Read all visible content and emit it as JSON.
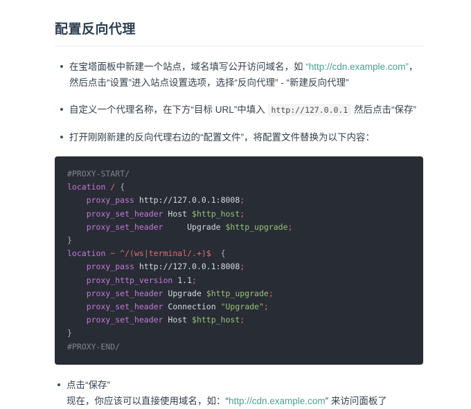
{
  "page": {
    "title": "配置反向代理"
  },
  "colors": {
    "link": "#4aa08c",
    "title": "#2c3e50",
    "code_background": "#282c34",
    "code_keyword": "#c678dd",
    "code_string": "#98c379",
    "code_comment": "#7f848e",
    "code_operator": "#e06c75",
    "code_plain": "#d7dae0"
  },
  "steps": [
    {
      "parts": [
        {
          "type": "text",
          "value": "在宝塔面板中新建一个站点，域名填写公开访问域名，如 "
        },
        {
          "type": "quote_open",
          "value": "“"
        },
        {
          "type": "link",
          "value": "http://cdn.example.com"
        },
        {
          "type": "quote_close",
          "value": "”"
        },
        {
          "type": "text",
          "value": "，然后点击“设置”进入站点设置选项，选择“反向代理” - “新建反向代理”"
        }
      ]
    },
    {
      "parts": [
        {
          "type": "text",
          "value": "自定义一个代理名称，在下方“目标 URL”中填入 "
        },
        {
          "type": "code",
          "value": "http://127.0.0.1"
        },
        {
          "type": "text",
          "value": " 然后点击“保存”"
        }
      ]
    },
    {
      "parts": [
        {
          "type": "text",
          "value": "打开刚刚新建的反向代理右边的“配置文件”，将配置文件替换为以下内容："
        }
      ]
    }
  ],
  "code_block": {
    "language": "nginx",
    "lines": [
      [
        {
          "t": "comment",
          "v": "#PROXY-START/"
        }
      ],
      [
        {
          "t": "keyword",
          "v": "location"
        },
        {
          "t": "plain",
          "v": " "
        },
        {
          "t": "operator",
          "v": "/"
        },
        {
          "t": "plain",
          "v": " "
        },
        {
          "t": "punct",
          "v": "{"
        }
      ],
      [
        {
          "t": "plain",
          "v": "    "
        },
        {
          "t": "keyword",
          "v": "proxy_pass"
        },
        {
          "t": "plain",
          "v": " http://127.0.0.1:8008"
        },
        {
          "t": "operator",
          "v": ";"
        }
      ],
      [
        {
          "t": "plain",
          "v": "    "
        },
        {
          "t": "keyword",
          "v": "proxy_set_header"
        },
        {
          "t": "plain",
          "v": " Host "
        },
        {
          "t": "var",
          "v": "$http_host"
        },
        {
          "t": "operator",
          "v": ";"
        }
      ],
      [
        {
          "t": "plain",
          "v": "    "
        },
        {
          "t": "keyword",
          "v": "proxy_set_header"
        },
        {
          "t": "plain",
          "v": "     Upgrade "
        },
        {
          "t": "var",
          "v": "$http_upgrade"
        },
        {
          "t": "operator",
          "v": ";"
        }
      ],
      [
        {
          "t": "punct",
          "v": "}"
        }
      ],
      [
        {
          "t": "keyword",
          "v": "location"
        },
        {
          "t": "plain",
          "v": " "
        },
        {
          "t": "operator",
          "v": "~"
        },
        {
          "t": "plain",
          "v": " "
        },
        {
          "t": "operator",
          "v": "^/(ws|terminal/.+)$"
        },
        {
          "t": "plain",
          "v": "  "
        },
        {
          "t": "punct",
          "v": "{"
        }
      ],
      [
        {
          "t": "plain",
          "v": "    "
        },
        {
          "t": "keyword",
          "v": "proxy_pass"
        },
        {
          "t": "plain",
          "v": " http://127.0.0.1:8008"
        },
        {
          "t": "operator",
          "v": ";"
        }
      ],
      [
        {
          "t": "plain",
          "v": "    "
        },
        {
          "t": "keyword",
          "v": "proxy_http_version"
        },
        {
          "t": "plain",
          "v": " 1.1"
        },
        {
          "t": "operator",
          "v": ";"
        }
      ],
      [
        {
          "t": "plain",
          "v": "    "
        },
        {
          "t": "keyword",
          "v": "proxy_set_header"
        },
        {
          "t": "plain",
          "v": " Upgrade "
        },
        {
          "t": "var",
          "v": "$http_upgrade"
        },
        {
          "t": "operator",
          "v": ";"
        }
      ],
      [
        {
          "t": "plain",
          "v": "    "
        },
        {
          "t": "keyword",
          "v": "proxy_set_header"
        },
        {
          "t": "plain",
          "v": " Connection "
        },
        {
          "t": "string",
          "v": "\"Upgrade\""
        },
        {
          "t": "operator",
          "v": ";"
        }
      ],
      [
        {
          "t": "plain",
          "v": "    "
        },
        {
          "t": "keyword",
          "v": "proxy_set_header"
        },
        {
          "t": "plain",
          "v": " Host "
        },
        {
          "t": "var",
          "v": "$http_host"
        },
        {
          "t": "operator",
          "v": ";"
        }
      ],
      [
        {
          "t": "punct",
          "v": "}"
        }
      ],
      [
        {
          "t": "comment",
          "v": "#PROXY-END/"
        }
      ]
    ]
  },
  "final_step": {
    "bullet_text": "点击“保存”",
    "continuation": {
      "prefix": "现在，你应该可以直接使用域名，如：“",
      "link": "http://cdn.example.com",
      "suffix": "” 来访问面板了"
    }
  }
}
